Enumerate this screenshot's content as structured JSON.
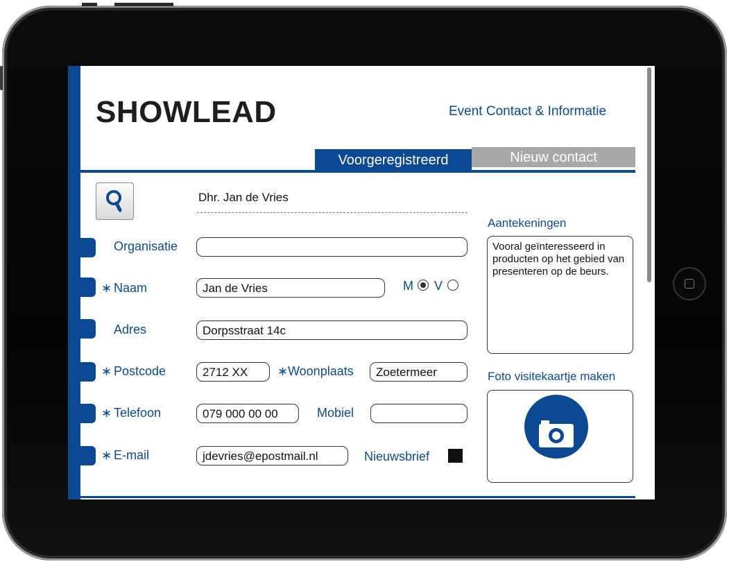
{
  "app": {
    "logo": "SHOWLEAD",
    "nav_links": "Event  Contact & Informatie"
  },
  "tabs": [
    {
      "label": "Voorgeregistreerd",
      "active": true
    },
    {
      "label": "Nieuw contact",
      "active": false
    }
  ],
  "search": {
    "icon": "search-icon",
    "selected_contact": "Dhr. Jan de Vries"
  },
  "form": {
    "organisatie": {
      "label": "Organisatie",
      "value": ""
    },
    "naam": {
      "required": "∗",
      "label": "Naam",
      "value": "Jan de Vries"
    },
    "gender": {
      "m_label": "M",
      "v_label": "V",
      "selected": "M"
    },
    "adres": {
      "label": "Adres",
      "value": "Dorpsstraat 14c"
    },
    "postcode": {
      "required": "∗",
      "label": "Postcode",
      "value": "2712 XX"
    },
    "woonplaats": {
      "required": "∗",
      "label": "Woonplaats",
      "value": "Zoetermeer"
    },
    "telefoon": {
      "required": "∗",
      "label": "Telefoon",
      "value": "079 000 00 00"
    },
    "mobiel": {
      "label": "Mobiel",
      "value": ""
    },
    "email": {
      "required": "∗",
      "label": "E-mail",
      "value": "jdevries@epostmail.nl"
    },
    "nieuwsbrief": {
      "label": "Nieuwsbrief",
      "checked": true
    }
  },
  "notes": {
    "title": "Aantekeningen",
    "text": "Vooral geïnteresseerd in producten op het gebied van presenteren op de beurs."
  },
  "photo": {
    "title": "Foto visitekaartje maken",
    "icon": "camera-icon"
  },
  "colors": {
    "brand": "#0b4a93",
    "tab_inactive": "#a8a8a8"
  }
}
